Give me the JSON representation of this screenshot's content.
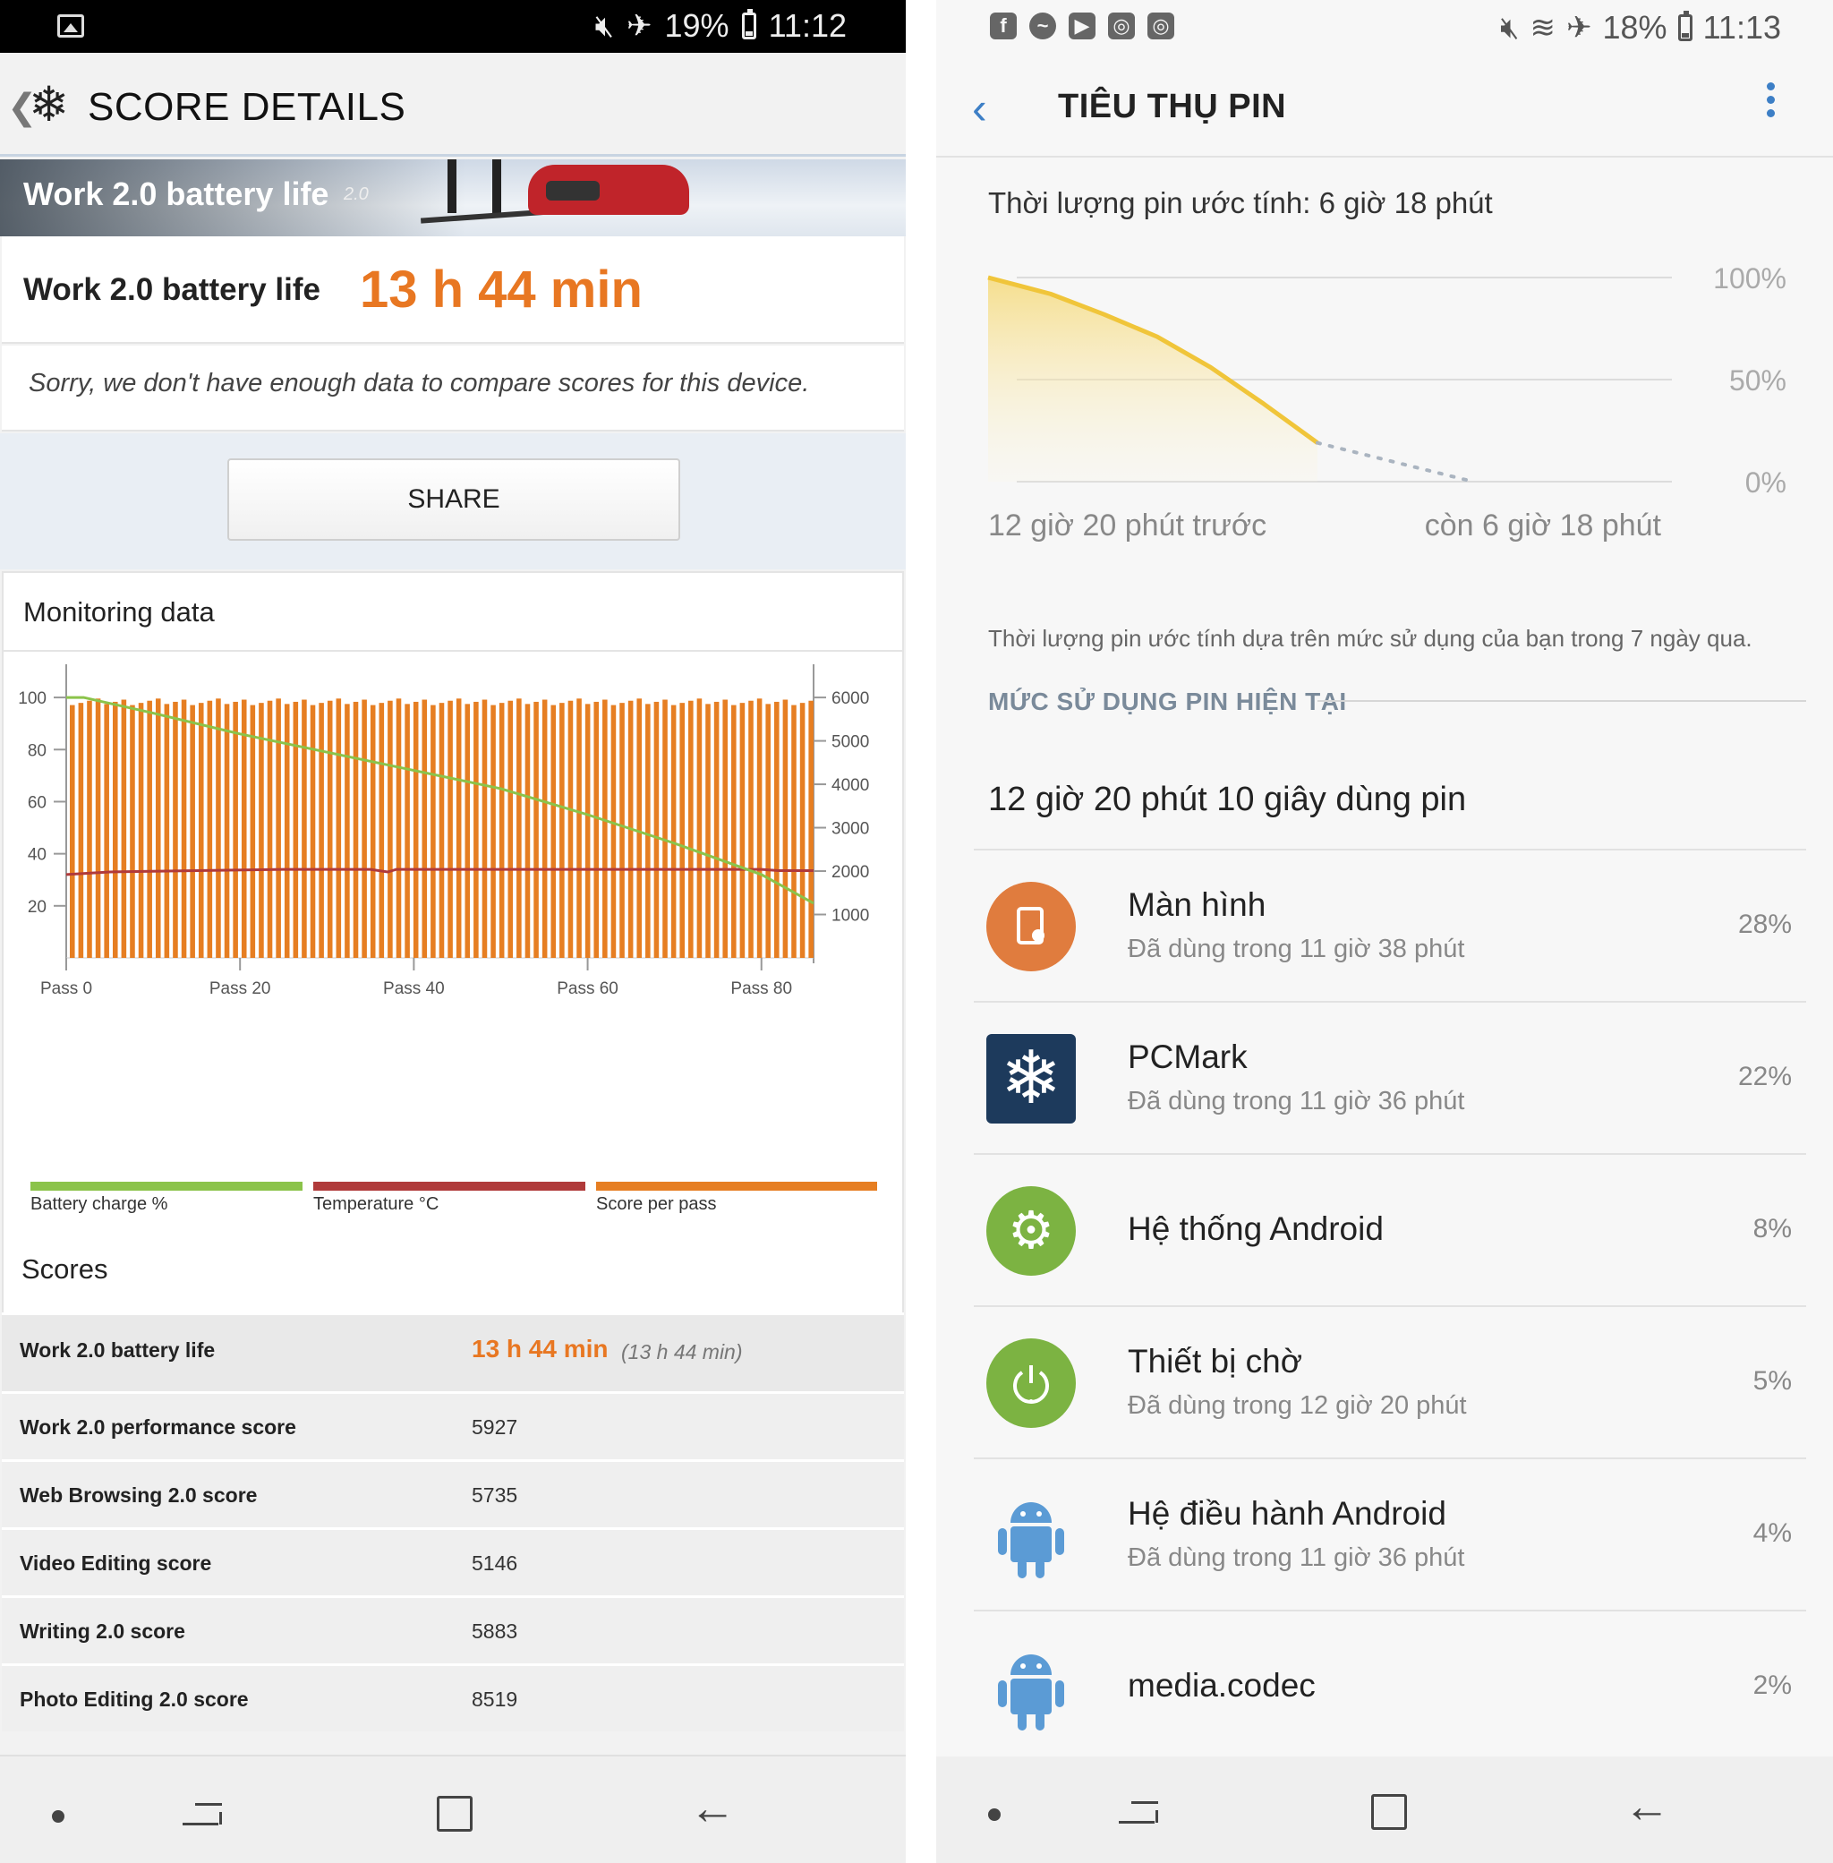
{
  "left": {
    "status": {
      "battery_pct": "19%",
      "time": "11:12"
    },
    "appbar": {
      "title": "SCORE DETAILS"
    },
    "banner": {
      "title": "Work 2.0 battery life",
      "version": "2.0"
    },
    "result": {
      "label": "Work 2.0 battery life",
      "value": "13 h 44 min"
    },
    "sorry": "Sorry, we don't have enough data to compare scores for this device.",
    "share_label": "SHARE",
    "monitoring_title": "Monitoring data",
    "legend": [
      {
        "label": "Battery charge %",
        "color": "#8bc34a"
      },
      {
        "label": "Temperature °C",
        "color": "#b03a3a"
      },
      {
        "label": "Score per pass",
        "color": "#e67e22"
      }
    ],
    "scores_title": "Scores",
    "scores": [
      {
        "name": "Work 2.0 battery life",
        "value": "13 h 44 min",
        "extra": "(13 h 44 min)"
      },
      {
        "name": "Work 2.0 performance score",
        "value": "5927"
      },
      {
        "name": "Web Browsing 2.0 score",
        "value": "5735"
      },
      {
        "name": "Video Editing score",
        "value": "5146"
      },
      {
        "name": "Writing 2.0 score",
        "value": "5883"
      },
      {
        "name": "Photo Editing 2.0 score",
        "value": "8519"
      }
    ]
  },
  "right": {
    "status": {
      "battery_pct": "18%",
      "time": "11:13"
    },
    "appbar": {
      "title": "TIÊU THỤ PIN"
    },
    "estimate": "Thời lượng pin ước tính: 6 giờ 18 phút",
    "chart_labels": {
      "y100": "100%",
      "y50": "50%",
      "y0": "0%",
      "x_left": "12 giờ 20 phút trước",
      "x_right": "còn 6 giờ 18 phút"
    },
    "note": "Thời lượng pin ước tính dựa trên mức sử dụng của bạn trong 7 ngày qua.",
    "section": "MỨC SỬ DỤNG PIN HIỆN TẠI",
    "usage": "12 giờ 20 phút 10 giây dùng pin",
    "apps": [
      {
        "name": "Màn hình",
        "sub": "Đã dùng trong 11 giờ 38 phút",
        "pct": "28%",
        "icon": "screen-icon",
        "color": "#e07c3e"
      },
      {
        "name": "PCMark",
        "sub": "Đã dùng trong 11 giờ 36 phút",
        "pct": "22%",
        "icon": "pcmark-icon",
        "color": "#1d3a5c"
      },
      {
        "name": "Hệ thống Android",
        "sub": "",
        "pct": "8%",
        "icon": "gear-icon",
        "color": "#7cb342"
      },
      {
        "name": "Thiết bị chờ",
        "sub": "Đã dùng trong 12 giờ 20 phút",
        "pct": "5%",
        "icon": "power-icon",
        "color": "#7cb342"
      },
      {
        "name": "Hệ điều hành Android",
        "sub": "Đã dùng trong 11 giờ 36 phút",
        "pct": "4%",
        "icon": "android-icon",
        "color": "#5b9bd5"
      },
      {
        "name": "media.codec",
        "sub": "",
        "pct": "2%",
        "icon": "android-icon",
        "color": "#5b9bd5"
      }
    ]
  },
  "chart_data": [
    {
      "type": "bar",
      "title": "Monitoring data",
      "x_ticks": [
        "Pass 0",
        "Pass 20",
        "Pass 40",
        "Pass 60",
        "Pass 80"
      ],
      "x_range": [
        0,
        86
      ],
      "y_left_ticks": [
        20,
        40,
        60,
        80,
        100
      ],
      "y_left_range": [
        0,
        110
      ],
      "y_right_ticks": [
        1000,
        2000,
        3000,
        4000,
        5000,
        6000
      ],
      "y_right_range": [
        0,
        6600
      ],
      "series": [
        {
          "name": "Score per pass",
          "axis": "right",
          "type": "bar",
          "count": 87,
          "approx_value": 5900
        },
        {
          "name": "Battery charge %",
          "axis": "left",
          "type": "line",
          "x": [
            0,
            2,
            10,
            20,
            30,
            40,
            50,
            60,
            70,
            80,
            86
          ],
          "y": [
            100,
            100,
            94,
            86,
            79,
            72,
            65,
            55,
            44,
            32,
            21
          ]
        },
        {
          "name": "Temperature °C",
          "axis": "left",
          "type": "line",
          "x": [
            0,
            5,
            15,
            25,
            35,
            37,
            38,
            39,
            50,
            60,
            70,
            80,
            82,
            86
          ],
          "y": [
            32,
            33,
            33.5,
            34,
            34,
            33,
            34,
            34,
            34,
            34,
            34,
            34,
            33.5,
            33.5
          ]
        }
      ]
    },
    {
      "type": "area",
      "title": "",
      "y_ticks": [
        "100%",
        "50%",
        "0%"
      ],
      "x_labels": [
        "12 giờ 20 phút trước",
        "còn 6 giờ 18 phút"
      ],
      "series": [
        {
          "name": "",
          "x_hours": [
            -12.33,
            -10,
            -8,
            -6,
            -4,
            -2,
            0
          ],
          "y": [
            100,
            92,
            82,
            71,
            56,
            38,
            19
          ]
        },
        {
          "name": "",
          "style": "dotted",
          "x_hours": [
            0,
            6.3
          ],
          "y": [
            19,
            0
          ]
        }
      ]
    }
  ]
}
